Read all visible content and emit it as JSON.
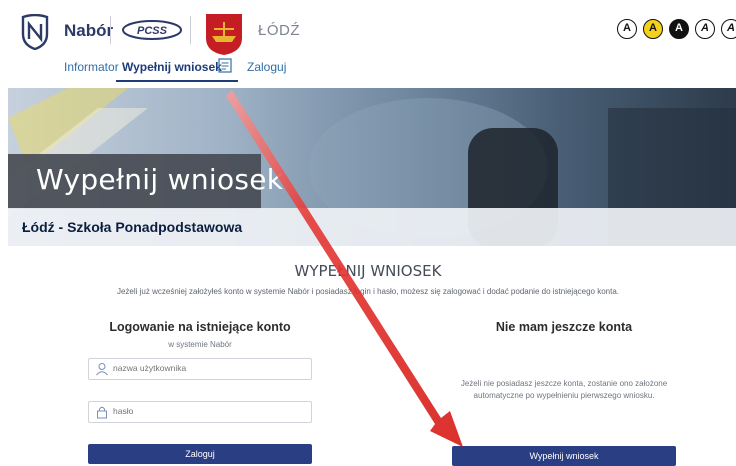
{
  "header": {
    "brand": "Nabór",
    "pcss_logo_text": "PCSS",
    "city": "ŁÓDŹ"
  },
  "accessibility": {
    "buttons": [
      "A",
      "A",
      "A",
      "A",
      "A"
    ]
  },
  "nav": {
    "items": [
      "Informator",
      "Wypełnij wniosek",
      "Zaloguj"
    ]
  },
  "hero": {
    "title": "Wypełnij wniosek",
    "subtitle": "Łódź - Szkoła Ponadpodstawowa"
  },
  "form": {
    "title": "WYPEŁNIJ WNIOSEK",
    "info": "Jeżeli już wcześniej założyłeś konto w systemie Nabór i posiadasz login i hasło, możesz się zalogować i dodać podanie do istniejącego konta.",
    "login": {
      "title": "Logowanie na istniejące konto",
      "subtitle": "w systemie Nabór",
      "username_placeholder": "nazwa użytkownika",
      "password_placeholder": "hasło",
      "button": "Zaloguj"
    },
    "no_account": {
      "title": "Nie mam jeszcze konta",
      "text_line1": "Jeżeli nie posiadasz jeszcze konta, zostanie ono założone",
      "text_line2": "automatyczne po wypełnieniu pierwszego wniosku.",
      "button": "Wypełnij wniosek"
    }
  },
  "colors": {
    "primary_button": "#2a3e84",
    "annotation_arrow": "#e0201c"
  }
}
